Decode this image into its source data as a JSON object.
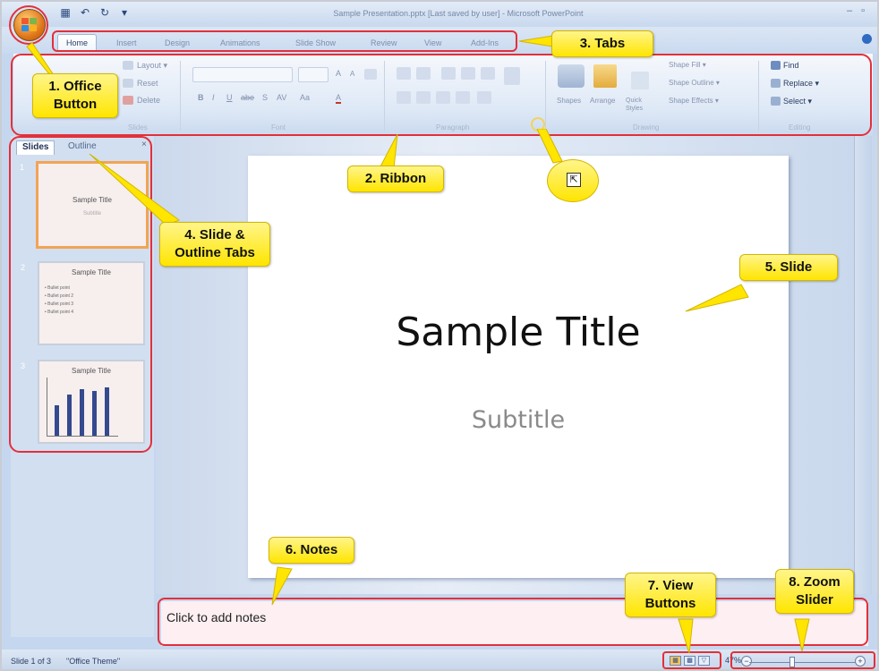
{
  "titlebar": {
    "title": "Sample Presentation.pptx [Last saved by user] - Microsoft PowerPoint",
    "min": "–",
    "max": "▫"
  },
  "quick_access": {
    "save_icon": "save-icon",
    "undo_icon": "undo-icon",
    "redo_icon": "redo-icon",
    "more_icon": "customize-icon"
  },
  "tabs": [
    "Home",
    "Insert",
    "Design",
    "Animations",
    "Slide Show",
    "Review",
    "View",
    "Add-Ins"
  ],
  "ribbon": {
    "slides_group": {
      "layout": "Layout ▾",
      "reset": "Reset",
      "delete": "Delete",
      "label": "Slides"
    },
    "font_group": {
      "label": "Font",
      "grow": "A",
      "shrink": "A",
      "bold": "B",
      "italic": "I",
      "underline": "U",
      "strike": "abe",
      "shadow": "S",
      "spacing": "AV",
      "case": "Aa",
      "color": "A"
    },
    "paragraph_group": {
      "label": "Paragraph"
    },
    "drawing_group": {
      "shapes": "Shapes",
      "arrange": "Arrange",
      "quick_styles": "Quick Styles",
      "shape_fill": "Shape Fill ▾",
      "shape_outline": "Shape Outline ▾",
      "shape_effects": "Shape Effects ▾",
      "label": "Drawing"
    },
    "editing_group": {
      "find": "Find",
      "replace": "Replace ▾",
      "select": "Select ▾",
      "label": "Editing"
    }
  },
  "left_pane": {
    "tab_slides": "Slides",
    "tab_outline": "Outline",
    "close": "×",
    "thumbs": [
      {
        "num": "1",
        "title": "Sample Title",
        "sub": "Subtitle"
      },
      {
        "num": "2",
        "title": "Sample Title",
        "bullets": [
          "• Bullet point",
          "• Bullet point 2",
          "• Bullet point 3",
          "• Bullet point 4"
        ]
      },
      {
        "num": "3",
        "title": "Sample Title"
      }
    ]
  },
  "slide": {
    "title": "Sample Title",
    "subtitle": "Subtitle"
  },
  "notes": {
    "placeholder": "Click to add notes"
  },
  "status": {
    "slide_count": "Slide 1 of 3",
    "theme": "\"Office Theme\"",
    "zoom": "47%",
    "zoom_level": 0.47
  },
  "callouts": {
    "office_button": "1. Office Button",
    "ribbon": "2. Ribbon",
    "tabs": "3. Tabs",
    "slide_outline_tabs": "4. Slide & Outline Tabs",
    "slide": "5. Slide",
    "notes": "6. Notes",
    "view_buttons": "7. View Buttons",
    "zoom_slider": "8. Zoom Slider"
  }
}
